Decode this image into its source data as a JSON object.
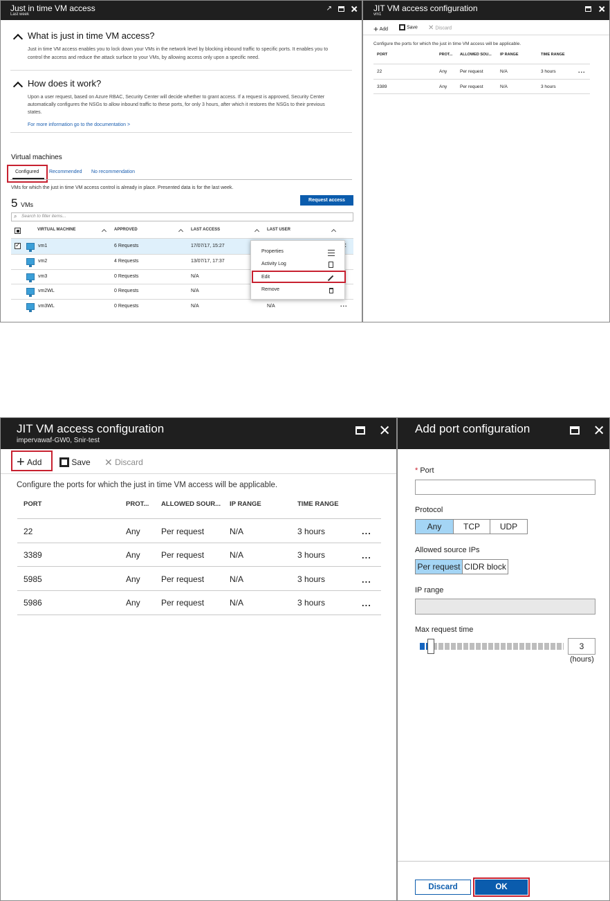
{
  "top_left_blade": {
    "title": "Just in time VM access",
    "subtitle": "Last week",
    "section1": {
      "heading": "What is just in time VM access?",
      "line1": "Just in time VM access enables you to lock down your VMs in the network level by blocking inbound traffic to specific ports. It enables you to",
      "line2": "control the access and reduce the attack surface to your VMs, by allowing access only upon a specific need."
    },
    "section2": {
      "heading": "How does it work?",
      "line1": "Upon a user request, based on Azure RBAC, Security Center will decide whether to grant access. If a request is approved, Security Center",
      "line2": "automatically configures the NSGs to allow inbound traffic to these ports, for only 3 hours, after which it restores the NSGs to their previous",
      "line3": "states.",
      "doc_link": "For more information go to the documentation >"
    },
    "vm_heading": "Virtual machines",
    "tabs": [
      "Configured",
      "Recommended",
      "No recommendation"
    ],
    "tab_description": "VMs for which the just in time VM access control is already in place. Presented data is for the last week.",
    "count": "5",
    "count_unit": "VMs",
    "request_access_button": "Request access",
    "search_placeholder": "Search to filter items...",
    "columns": [
      "VIRTUAL MACHINE",
      "APPROVED",
      "LAST ACCESS",
      "LAST USER"
    ],
    "rows": [
      {
        "vm": "vm1",
        "approved": "6 Requests",
        "last_access": "17/07/17, 15:27",
        "last_user": ""
      },
      {
        "vm": "vm2",
        "approved": "4 Requests",
        "last_access": "13/07/17, 17:37",
        "last_user": ""
      },
      {
        "vm": "vm3",
        "approved": "0 Requests",
        "last_access": "N/A",
        "last_user": ""
      },
      {
        "vm": "vm2WL",
        "approved": "0 Requests",
        "last_access": "N/A",
        "last_user": ""
      },
      {
        "vm": "vm3WL",
        "approved": "0 Requests",
        "last_access": "N/A",
        "last_user": "N/A"
      }
    ],
    "context_menu": [
      "Properties",
      "Activity Log",
      "Edit",
      "Remove"
    ]
  },
  "top_right_blade": {
    "title": "JIT VM access configuration",
    "subtitle": "vm1",
    "toolbar": {
      "add": "Add",
      "save": "Save",
      "discard": "Discard"
    },
    "description": "Configure the ports for which the just in time VM access will be applicable.",
    "columns": [
      "PORT",
      "PROT...",
      "ALLOWED SOU...",
      "IP RANGE",
      "TIME RANGE"
    ],
    "rows": [
      {
        "port": "22",
        "protocol": "Any",
        "source": "Per request",
        "ip_range": "N/A",
        "time_range": "3 hours"
      },
      {
        "port": "3389",
        "protocol": "Any",
        "source": "Per request",
        "ip_range": "N/A",
        "time_range": "3 hours"
      }
    ]
  },
  "bottom_left_blade": {
    "title": "JIT VM access configuration",
    "subtitle": "impervawaf-GW0, Snir-test",
    "toolbar": {
      "add": "Add",
      "save": "Save",
      "discard": "Discard"
    },
    "description": "Configure the ports for which the just in time VM access will be applicable.",
    "columns": [
      "PORT",
      "PROT...",
      "ALLOWED SOUR...",
      "IP RANGE",
      "TIME RANGE"
    ],
    "rows": [
      {
        "port": "22",
        "protocol": "Any",
        "source": "Per request",
        "ip_range": "N/A",
        "time_range": "3 hours"
      },
      {
        "port": "3389",
        "protocol": "Any",
        "source": "Per request",
        "ip_range": "N/A",
        "time_range": "3 hours"
      },
      {
        "port": "5985",
        "protocol": "Any",
        "source": "Per request",
        "ip_range": "N/A",
        "time_range": "3 hours"
      },
      {
        "port": "5986",
        "protocol": "Any",
        "source": "Per request",
        "ip_range": "N/A",
        "time_range": "3 hours"
      }
    ]
  },
  "bottom_right_blade": {
    "title": "Add port configuration",
    "port_label": "Port",
    "required_mark": "*",
    "protocol_label": "Protocol",
    "protocol_options": [
      "Any",
      "TCP",
      "UDP"
    ],
    "protocol_selected": "Any",
    "source_label": "Allowed source IPs",
    "source_options": [
      "Per request",
      "CIDR block"
    ],
    "source_selected": "Per request",
    "ip_range_label": "IP range",
    "max_time_label": "Max request time",
    "max_time_value": "3",
    "max_time_unit": "(hours)",
    "max_time_fraction": 0.125,
    "discard_button": "Discard",
    "ok_button": "OK"
  },
  "colors": {
    "titlebar": "#1f1f1f",
    "accent": "#0b5cad",
    "highlight": "#c7202f",
    "selected_segment": "#a4d5f5"
  }
}
